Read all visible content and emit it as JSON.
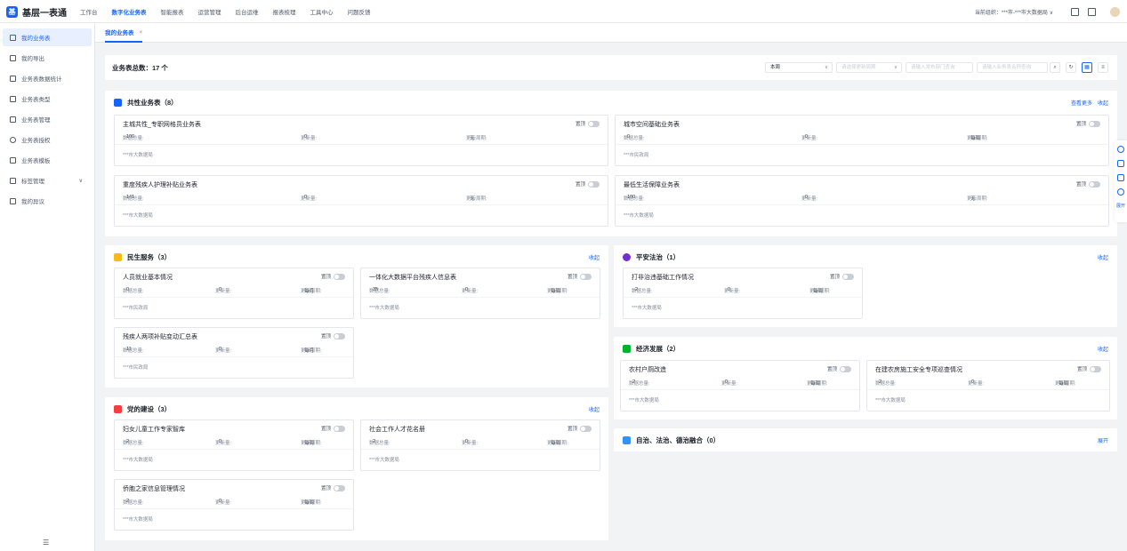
{
  "app": {
    "logo_char": "基",
    "title": "基层一表通"
  },
  "nav": [
    "工作台",
    "数字化业务表",
    "智能报表",
    "运营管理",
    "后台运维",
    "报表梳理",
    "工具中心",
    "问题反馈"
  ],
  "org_label": "当前组织：***市-***市大数据局",
  "org_arrow": "∨",
  "sidebar": [
    {
      "label": "我的业务表",
      "active": true
    },
    {
      "label": "我的导出"
    },
    {
      "label": "业务表数据统计"
    },
    {
      "label": "业务表类型"
    },
    {
      "label": "业务表管理"
    },
    {
      "label": "业务表授权"
    },
    {
      "label": "业务表模板"
    },
    {
      "label": "标签管理",
      "chevron": "∨"
    },
    {
      "label": "我的异议"
    }
  ],
  "sidebar_collapse": "☰",
  "tab": {
    "label": "我的业务表",
    "close": "×"
  },
  "filter": {
    "total_label": "业务表总数：",
    "total_count": "17 个",
    "period_value": "本周",
    "update_placeholder": "请选择更新周期",
    "dept_placeholder": "请输入发布部门查询",
    "name_placeholder": "请输入业务表名称查询",
    "search_icon": "⌕",
    "refresh_icon": "↻",
    "grid_icon": "▦",
    "list_icon": "≡"
  },
  "labels": {
    "pin": "置顶",
    "total": "数据总量:",
    "update": "更新量:",
    "cycle": "更新周期:",
    "view_more": "查看更多",
    "collapse": "收起",
    "expand": "展开"
  },
  "sections": {
    "shared": {
      "title": "共性业务表（8）",
      "cards": [
        {
          "title": "主城共性_专职网格员业务表",
          "total": "100",
          "update": "0",
          "cycle": "无",
          "dept": "***市大数据局"
        },
        {
          "title": "城市空间基础业务表",
          "total": "0",
          "update": "0",
          "cycle": "每周",
          "dept": "***市民政局"
        },
        {
          "title": "重度残疾人护理补贴业务表",
          "total": "141",
          "update": "0",
          "cycle": "无",
          "dept": "***市大数据局"
        },
        {
          "title": "最低生活保障业务表",
          "total": "100",
          "update": "0",
          "cycle": "无",
          "dept": "***市大数据局"
        }
      ]
    },
    "livelihood": {
      "title": "民生服务（3）",
      "cards": [
        {
          "title": "人员就业基本情况",
          "total": "0",
          "update": "0",
          "cycle": "每月",
          "dept": "***市民政局"
        },
        {
          "title": "一体化大数据平台残疾人信息表",
          "total": "35",
          "update": "0",
          "cycle": "每周",
          "dept": "***市大数据局"
        },
        {
          "title": "残疾人两项补贴变动汇总表",
          "total": "11",
          "update": "0",
          "cycle": "每月",
          "dept": "***市民政局"
        }
      ]
    },
    "safety": {
      "title": "平安法治（1）",
      "cards": [
        {
          "title": "打非治违基础工作情况",
          "total": "2",
          "update": "0",
          "cycle": "每周",
          "dept": "***市大数据局"
        }
      ]
    },
    "economy": {
      "title": "经济发展（2）",
      "cards": [
        {
          "title": "农村户厕改造",
          "total": "2",
          "update": "0",
          "cycle": "每周",
          "dept": "***市大数据局"
        },
        {
          "title": "在建农房施工安全专项巡查情况",
          "total": "2",
          "update": "0",
          "cycle": "每周",
          "dept": "***市大数据局"
        }
      ]
    },
    "party": {
      "title": "党的建设（3）",
      "cards": [
        {
          "title": "妇女儿童工作专家智库",
          "total": "2",
          "update": "0",
          "cycle": "每周",
          "dept": "***市大数据局"
        },
        {
          "title": "社会工作人才花名册",
          "total": "2",
          "update": "0",
          "cycle": "每周",
          "dept": "***市大数据局"
        },
        {
          "title": "侨胞之家信息管理情况",
          "total": "2",
          "update": "0",
          "cycle": "每周",
          "dept": "***市大数据局"
        }
      ]
    },
    "governance": {
      "title": "自治、法治、德治融合（0）"
    }
  },
  "colors": {
    "accent": "#1664ff",
    "shared_icon": "#1664ff",
    "livelihood_icon": "#f7ba1e",
    "safety_icon": "#722ed1",
    "economy_icon": "#00b42a",
    "party_icon": "#f53f3f",
    "governance_icon": "#3491fa"
  }
}
